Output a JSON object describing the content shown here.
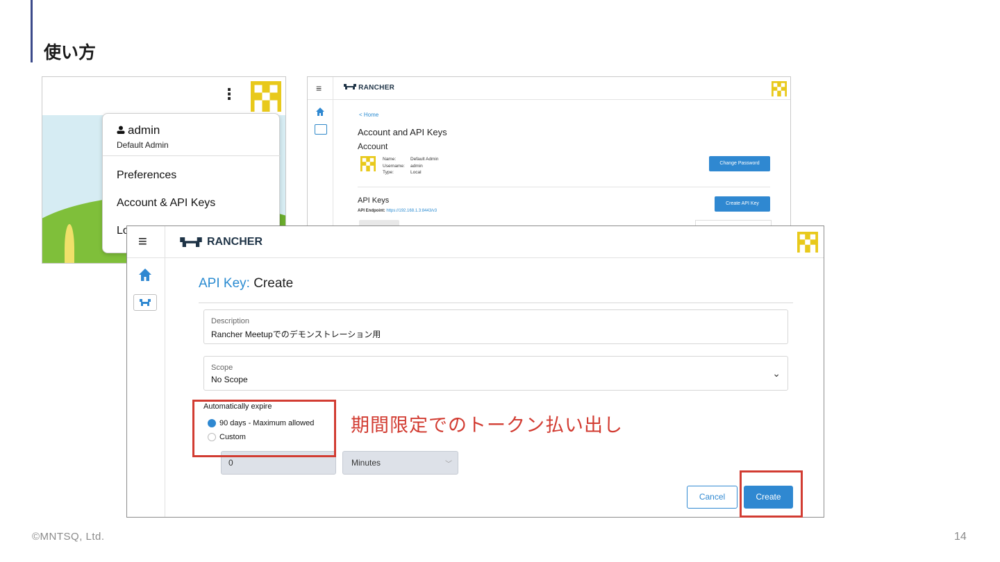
{
  "slide": {
    "title": "使い方",
    "footer": "©MNTSQ, Ltd.",
    "page_number": "14",
    "annotation": "期間限定でのトークン払い出し",
    "colors": {
      "accent": "#3b4a8a",
      "annotation_red": "#d23c32",
      "rancher_blue": "#2f88d1"
    }
  },
  "user_menu": {
    "kebab": "⋮",
    "username": "admin",
    "role": "Default Admin",
    "items": [
      "Preferences",
      "Account & API Keys",
      "Lo"
    ]
  },
  "account_page": {
    "brand": "RANCHER",
    "back_link": "< Home",
    "title": "Account and API Keys",
    "section_account": "Account",
    "fields": [
      {
        "key": "Name:",
        "value": "Default Admin"
      },
      {
        "key": "Username:",
        "value": "admin"
      },
      {
        "key": "Type:",
        "value": "Local"
      }
    ],
    "change_password": "Change Password",
    "section_api": "API Keys",
    "endpoint_label": "API Endpoint:",
    "endpoint_url": "https://192.168.1.3:8443/v3",
    "create_api_key": "Create API Key"
  },
  "api_key_create": {
    "brand": "RANCHER",
    "title_prefix": "API Key:",
    "title": "Create",
    "description": {
      "label": "Description",
      "value": "Rancher Meetupでのデモンストレーション用"
    },
    "scope": {
      "label": "Scope",
      "value": "No Scope"
    },
    "expire_label": "Automatically expire",
    "expire_options": [
      {
        "label": "90 days - Maximum allowed",
        "selected": true
      },
      {
        "label": "Custom",
        "selected": false
      }
    ],
    "custom_value": "0",
    "custom_unit": "Minutes",
    "cancel": "Cancel",
    "create": "Create"
  }
}
